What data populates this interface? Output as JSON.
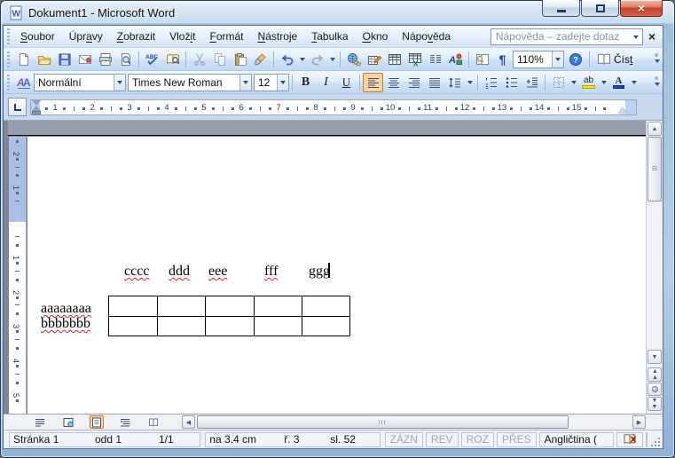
{
  "window": {
    "title": "Dokument1 - Microsoft Word"
  },
  "menu_bar": {
    "items": [
      {
        "label": "Soubor",
        "u": 0
      },
      {
        "label": "Úpravy",
        "u": 3
      },
      {
        "label": "Zobrazit",
        "u": 0
      },
      {
        "label": "Vložit",
        "u": 4
      },
      {
        "label": "Formát",
        "u": 0
      },
      {
        "label": "Nástroje",
        "u": 0
      },
      {
        "label": "Tabulka",
        "u": 0
      },
      {
        "label": "Okno",
        "u": 0
      },
      {
        "label": "Nápověda",
        "u": 4
      }
    ],
    "help_query_placeholder": "Nápověda – zadejte dotaz"
  },
  "standard_toolbar": {
    "spelling_label": "ABC",
    "show_marks_label": "¶",
    "zoom_value": "110%",
    "read_label": "Číst",
    "read_u": 3
  },
  "formatting_toolbar": {
    "style_value": "Normální",
    "font_value": "Times New Roman",
    "size_value": "12",
    "bold_label": "B",
    "italic_label": "I",
    "underline_label": "U",
    "highlight_label": "ab",
    "font_color_label": "A"
  },
  "ruler": {
    "horizontal_numbers": [
      1,
      2,
      3,
      4,
      5,
      6,
      7,
      8,
      9,
      10,
      11,
      12,
      13,
      14,
      15
    ],
    "vertical_top_numbers": [
      2,
      1
    ],
    "vertical_numbers": [
      1,
      2,
      3,
      4,
      5
    ]
  },
  "document": {
    "tab_line": {
      "words": [
        "cccc",
        "ddd",
        "eee",
        "fff",
        "ggg"
      ],
      "x_positions": [
        109,
        159,
        204,
        267,
        317
      ]
    },
    "left_lines": [
      "aaaaaaaa",
      "bbbbbbb"
    ],
    "table": {
      "rows": 2,
      "cols": 5
    }
  },
  "status_bar": {
    "page": "Stránka 1",
    "section": "odd 1",
    "page_of_total": "1/1",
    "position": "na 3.4 cm",
    "line": "ř. 3",
    "column": "sl. 52",
    "record_mode": "ZÁZN",
    "revision_mode": "REV",
    "extend_mode": "ROZ",
    "overtype_mode": "PŘES",
    "language": "Angličtina ("
  },
  "colors": {
    "toolbar_selected": "#fbd5a2",
    "toolbar_selected_border": "#c57b2b",
    "squiggle_red": "#e02020",
    "close_button_red": "#c14228",
    "page_gap_gray": "#959cab",
    "ruler_margin_blue": "#bdd2ee"
  }
}
